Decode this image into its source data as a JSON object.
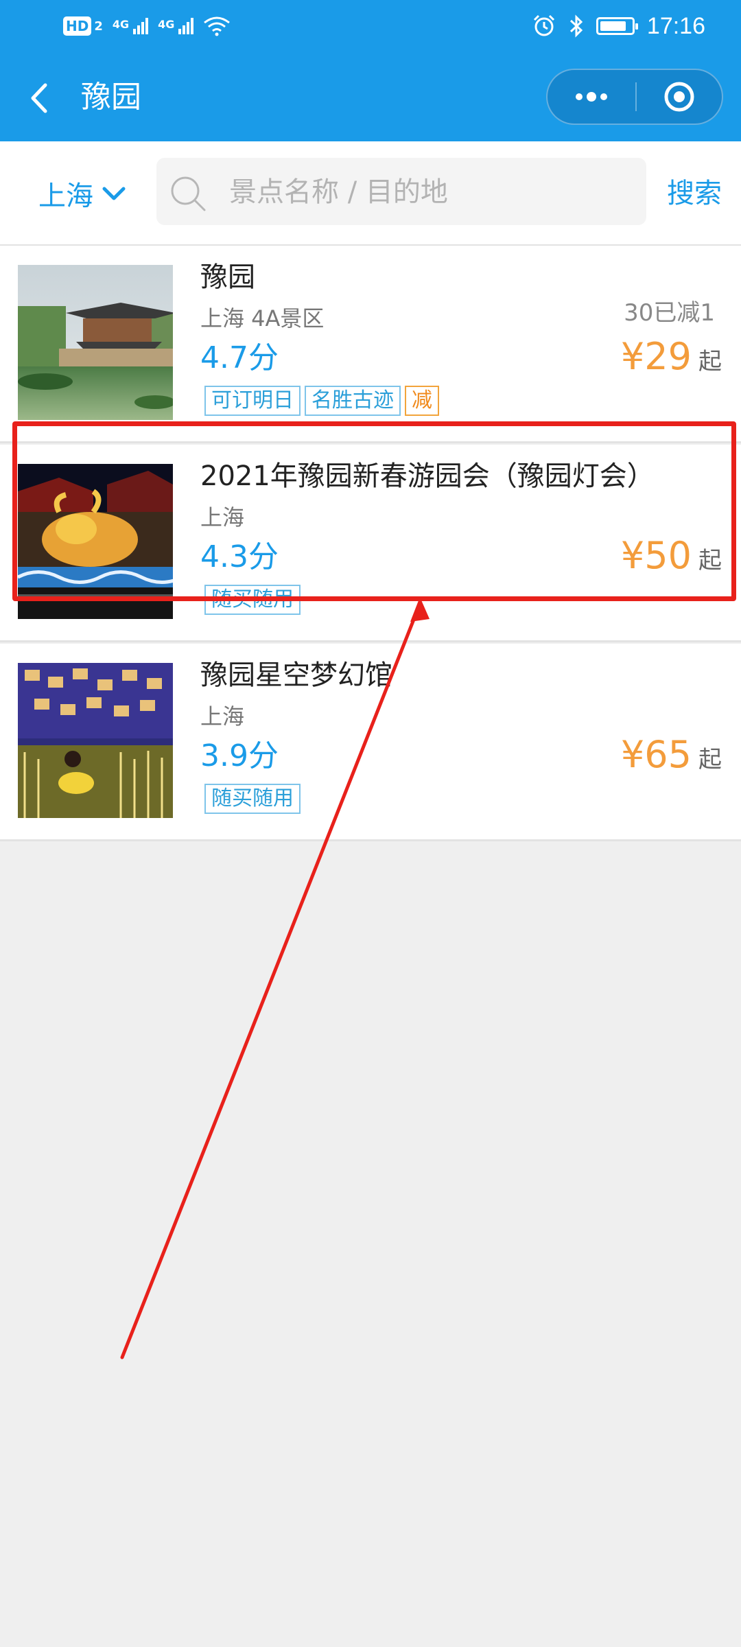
{
  "status_bar": {
    "hd": "HD",
    "hd_sub": "2",
    "net1": "4G",
    "net2": "4G",
    "time": "17:16",
    "battery_level": 0.85
  },
  "header": {
    "title": "豫园"
  },
  "search": {
    "city": "上海",
    "placeholder": "景点名称 / 目的地",
    "button": "搜索"
  },
  "items": [
    {
      "title": "豫园",
      "location": "上海  4A景区",
      "promo": "30已减1",
      "score": "4.7分",
      "price": "¥29",
      "price_unit": "起",
      "tags": [
        "可订明日",
        "名胜古迹",
        "减"
      ]
    },
    {
      "title": "2021年豫园新春游园会（豫园灯会）",
      "location": "上海",
      "score": "4.3分",
      "price": "¥50",
      "price_unit": "起",
      "tags": [
        "随买随用"
      ]
    },
    {
      "title": "豫园星空梦幻馆",
      "location": "上海",
      "score": "3.9分",
      "price": "¥65",
      "price_unit": "起",
      "tags": [
        "随买随用"
      ]
    }
  ],
  "colors": {
    "brand": "#1a9be8",
    "price": "#f39c3b",
    "annotation": "#e8211b"
  }
}
